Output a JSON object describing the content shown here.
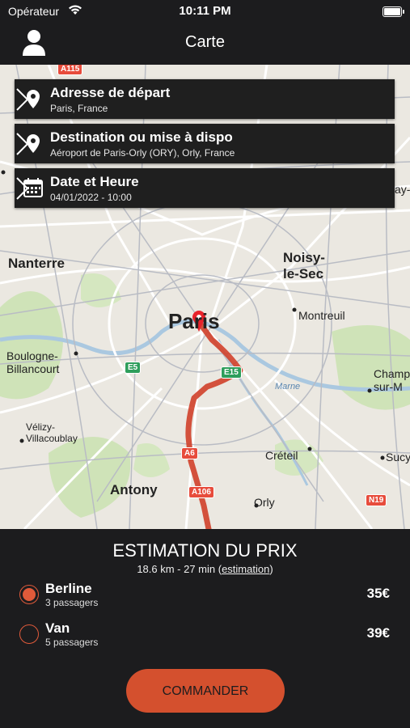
{
  "status_bar": {
    "carrier": "Opérateur",
    "time": "10:11 PM"
  },
  "nav": {
    "title": "Carte",
    "profile_icon": "person-icon"
  },
  "form": {
    "departure": {
      "title": "Adresse de départ",
      "value": "Paris, France",
      "icon": "location-pin-icon"
    },
    "destination": {
      "title": "Destination ou mise à dispo",
      "value": "Aéroport de Paris-Orly (ORY), Orly, France",
      "icon": "location-pin-icon"
    },
    "datetime": {
      "title": "Date et Heure",
      "value": "04/01/2022 - 10:00",
      "icon": "calendar-icon"
    }
  },
  "map": {
    "labels": {
      "nanterre": "Nanterre",
      "noisy": "Noisy-\nle-Sec",
      "paris": "Paris",
      "montreuil": "Montreuil",
      "boulogne": "Boulogne-\nBillancourt",
      "champ": "Champ\nsur-M",
      "velizy": "Vélizy-\nVillacoublay",
      "creteil": "Créteil",
      "sucy": "Sucy",
      "antony": "Antony",
      "orly": "Orly",
      "marne": "Marne",
      "bay": "ay-"
    },
    "shields": {
      "a115": "A115",
      "e5": "E5",
      "e15": "E15",
      "a6": "A6",
      "a106": "A106",
      "n19": "N19"
    },
    "route_color": "#d0402a"
  },
  "estimate": {
    "title": "ESTIMATION DU PRIX",
    "summary": "18.6 km - 27 min (",
    "link": "estimation",
    "close": ")"
  },
  "vehicles": [
    {
      "name": "Berline",
      "capacity": "3 passagers",
      "price": "35€",
      "selected": true
    },
    {
      "name": "Van",
      "capacity": "5 passagers",
      "price": "39€",
      "selected": false
    }
  ],
  "order_button": "COMMANDER",
  "colors": {
    "accent": "#d4502e",
    "background": "#1c1c1e"
  }
}
